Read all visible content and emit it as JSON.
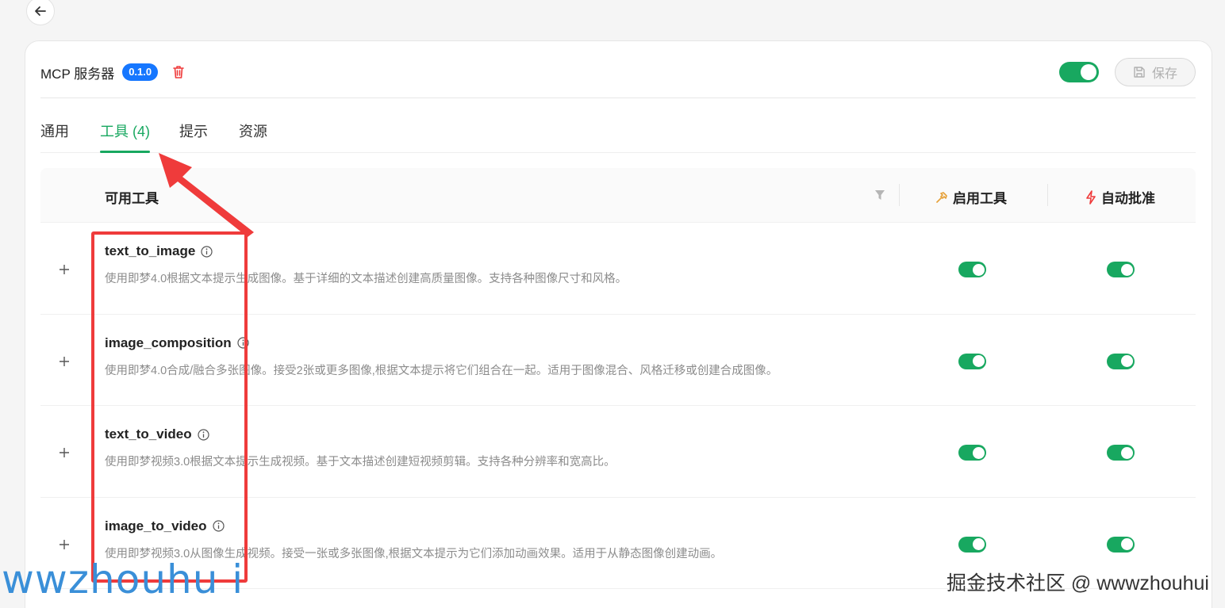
{
  "header": {
    "title": "MCP 服务器",
    "version": "0.1.0",
    "save_label": "保存",
    "enabled": true
  },
  "tabs": [
    {
      "label": "通用",
      "active": false
    },
    {
      "label": "工具 (4)",
      "active": true
    },
    {
      "label": "提示",
      "active": false
    },
    {
      "label": "资源",
      "active": false
    }
  ],
  "table": {
    "col_tools": "可用工具",
    "col_enable": "启用工具",
    "col_approve": "自动批准",
    "rows": [
      {
        "name": "text_to_image",
        "desc": "使用即梦4.0根据文本提示生成图像。基于详细的文本描述创建高质量图像。支持各种图像尺寸和风格。",
        "enabled": true,
        "auto_approve": true
      },
      {
        "name": "image_composition",
        "desc": "使用即梦4.0合成/融合多张图像。接受2张或更多图像,根据文本提示将它们组合在一起。适用于图像混合、风格迁移或创建合成图像。",
        "enabled": true,
        "auto_approve": true
      },
      {
        "name": "text_to_video",
        "desc": "使用即梦视频3.0根据文本提示生成视频。基于文本描述创建短视频剪辑。支持各种分辨率和宽高比。",
        "enabled": true,
        "auto_approve": true
      },
      {
        "name": "image_to_video",
        "desc": "使用即梦视频3.0从图像生成视频。接受一张或多张图像,根据文本提示为它们添加动画效果。适用于从静态图像创建动画。",
        "enabled": true,
        "auto_approve": true
      }
    ]
  },
  "watermarks": {
    "left": "wwzhouhu i",
    "right": "掘金技术社区 @ wwwzhouhui"
  },
  "colors": {
    "accent": "#18a860",
    "badge": "#1677ff",
    "danger": "#ef3b3b",
    "enable_icon": "#e6a23c"
  }
}
